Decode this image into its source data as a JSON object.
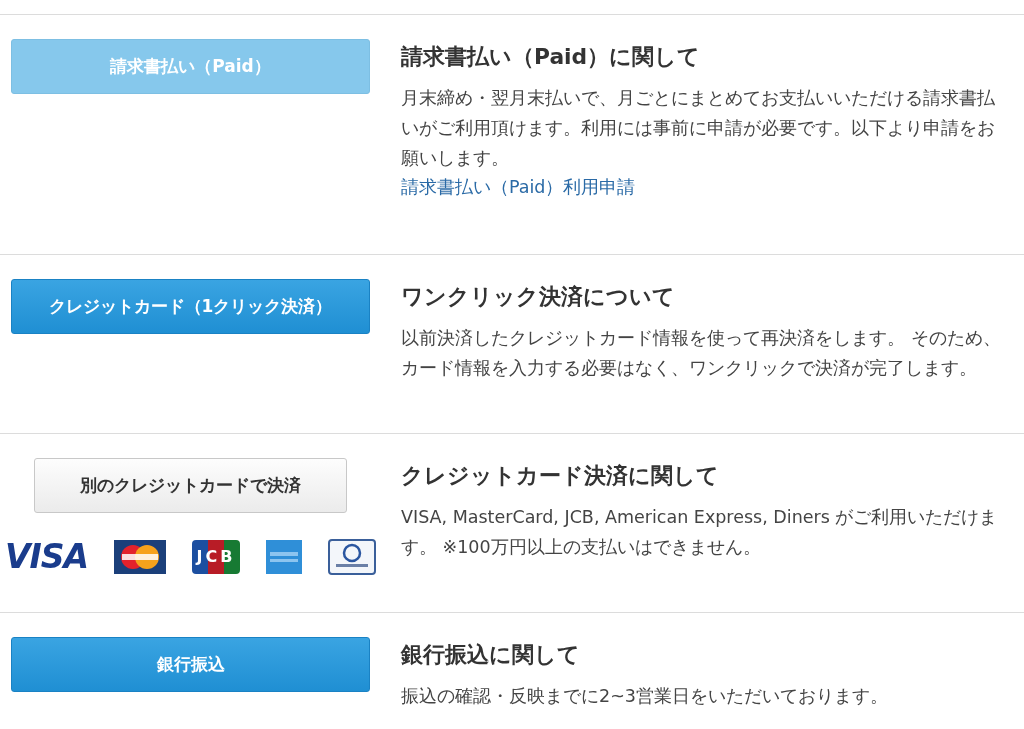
{
  "sections": [
    {
      "button": {
        "label": "請求書払い（Paid）",
        "kind": "light"
      },
      "title": "請求書払い（Paid）に関して",
      "body": "月末締め・翌月末払いで、月ごとにまとめてお支払いいただける請求書払いがご利用頂けます。利用には事前に申請が必要です。以下より申請をお願いします。",
      "link": "請求書払い（Paid）利用申請"
    },
    {
      "button": {
        "label": "クレジットカード（1クリック決済）",
        "kind": "primary"
      },
      "title": "ワンクリック決済について",
      "body": "以前決済したクレジットカード情報を使って再決済をします。 そのため、カード情報を入力する必要はなく、ワンクリックで決済が完了します。"
    },
    {
      "button": {
        "label": "別のクレジットカードで決済",
        "kind": "secondary"
      },
      "card_logos": [
        {
          "kind": "visa",
          "text": "VISA"
        },
        {
          "kind": "mastercard"
        },
        {
          "kind": "jcb",
          "text": "JCB"
        },
        {
          "kind": "amex"
        },
        {
          "kind": "diners"
        }
      ],
      "title": "クレジットカード決済に関して",
      "body": "VISA, MasterCard, JCB, American Express, Diners がご利用いただけます。 ※100万円以上の支払いはできません。"
    },
    {
      "button": {
        "label": "銀行振込",
        "kind": "primary"
      },
      "title": "銀行振込に関して",
      "body": "振込の確認・反映までに2~3営業日をいただいております。"
    }
  ]
}
